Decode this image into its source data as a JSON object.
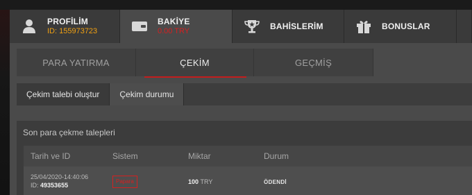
{
  "top_tabs": {
    "profile": {
      "title": "PROFİLİM",
      "sub": "ID: 155973723"
    },
    "balance": {
      "title": "BAKİYE",
      "sub": "0.00 TRY"
    },
    "bets": {
      "title": "BAHİSLERİM"
    },
    "bonus": {
      "title": "BONUSLAR"
    }
  },
  "sub_tabs": {
    "deposit": "PARA YATIRMA",
    "withdraw": "ÇEKİM",
    "history": "GEÇMİŞ"
  },
  "section_tabs": {
    "create": "Çekim talebi oluştur",
    "status": "Çekim durumu"
  },
  "list": {
    "title": "Son para çekme talepleri",
    "headers": [
      "Tarih ve ID",
      "Sistem",
      "Miktar",
      "Durum"
    ],
    "rows": [
      {
        "date": "25/04/2020-14:40:06",
        "id_label": "ID:",
        "id": "49353655",
        "system": "Papara",
        "amount": "100",
        "currency": "TRY",
        "status": "ÖDENDİ"
      }
    ]
  },
  "colors": {
    "accent_red": "#c41d1d",
    "id_orange": "#f0a012"
  }
}
